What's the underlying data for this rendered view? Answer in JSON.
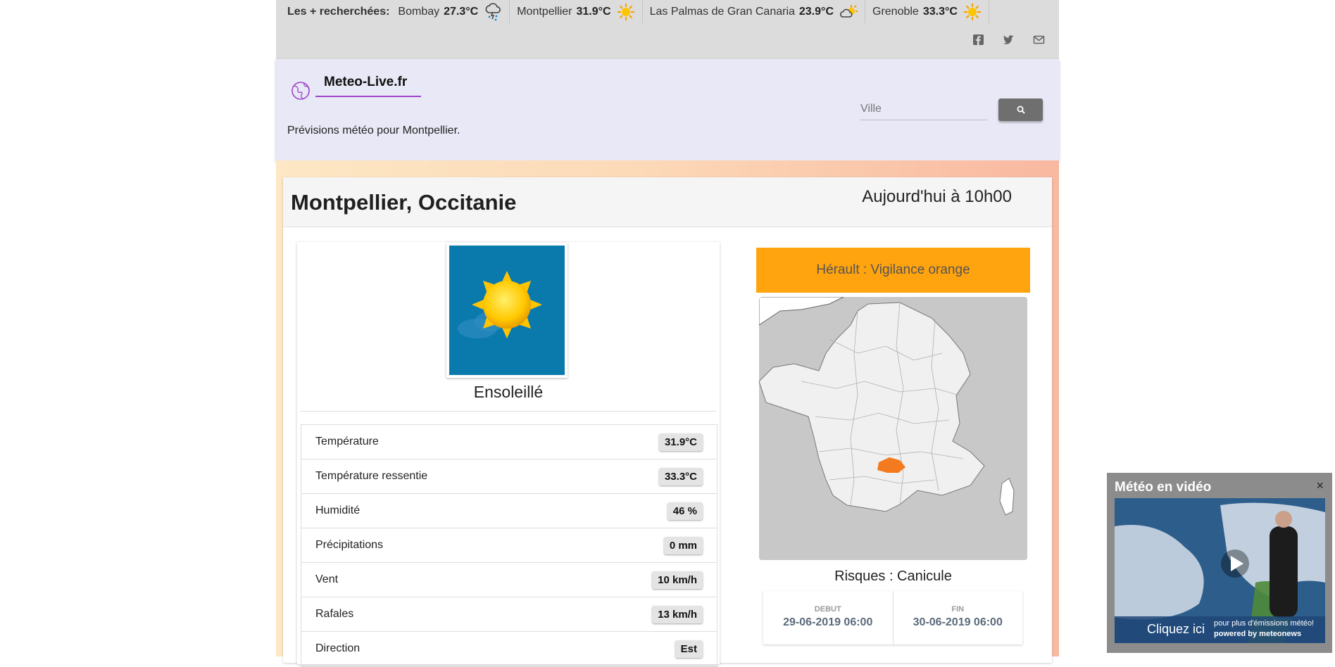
{
  "topbar": {
    "trending_title": "Les + recherchées:",
    "trending": [
      {
        "city": "Bombay",
        "temp": "27.3°C",
        "icon": "thunder-rain-icon"
      },
      {
        "city": "Montpellier",
        "temp": "31.9°C",
        "icon": "sun-icon"
      },
      {
        "city": "Las Palmas de Gran Canaria",
        "temp": "23.9°C",
        "icon": "sun-cloud-icon"
      },
      {
        "city": "Grenoble",
        "temp": "33.3°C",
        "icon": "sun-icon"
      }
    ],
    "social": [
      "facebook-icon",
      "twitter-icon",
      "mail-icon"
    ]
  },
  "header": {
    "logo_text": "Meteo-Live.fr",
    "subtitle": "Prévisions météo pour Montpellier.",
    "search_placeholder": "Ville",
    "accent_color": "#9b46c8"
  },
  "main": {
    "city_title": "Montpellier, Occitanie",
    "time_label": "Aujourd'hui à 10h00",
    "condition": "Ensoleillé",
    "stats": [
      {
        "label": "Température",
        "value": "31.9°C"
      },
      {
        "label": "Température ressentie",
        "value": "33.3°C"
      },
      {
        "label": "Humidité",
        "value": "46 %"
      },
      {
        "label": "Précipitations",
        "value": "0 mm"
      },
      {
        "label": "Vent",
        "value": "10 km/h"
      },
      {
        "label": "Rafales",
        "value": "13 km/h"
      },
      {
        "label": "Direction",
        "value": "Est"
      }
    ]
  },
  "vigilance": {
    "title": "Hérault : Vigilance orange",
    "color": "#ffa30f",
    "risk": "Risques : Canicule",
    "start_label": "DEBUT",
    "start_value": "29-06-2019 06:00",
    "end_label": "FIN",
    "end_value": "30-06-2019 06:00"
  },
  "video": {
    "title": "Météo en vidéo",
    "close": "×",
    "cta": "Cliquez ici",
    "note_line1": "pour plus d'émissions météo!",
    "note_line2": "powered by meteonews"
  }
}
